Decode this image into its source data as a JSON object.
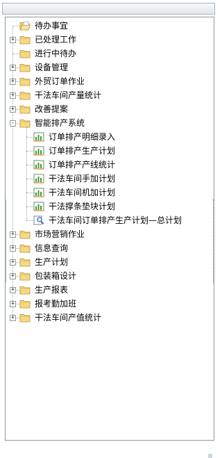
{
  "tree": {
    "items": [
      {
        "label": "待办事宜",
        "level": 0,
        "expander": "none",
        "icon": "folder-open-icon"
      },
      {
        "label": "已处理工作",
        "level": 0,
        "expander": "+",
        "icon": "folder-icon"
      },
      {
        "label": "进行中待办",
        "level": 0,
        "expander": "none",
        "icon": "folder-icon"
      },
      {
        "label": "设备管理",
        "level": 0,
        "expander": "+",
        "icon": "folder-icon"
      },
      {
        "label": "外贸订单作业",
        "level": 0,
        "expander": "+",
        "icon": "folder-icon"
      },
      {
        "label": "干法车间产量统计",
        "level": 0,
        "expander": "+",
        "icon": "folder-icon"
      },
      {
        "label": "改善提案",
        "level": 0,
        "expander": "+",
        "icon": "folder-icon"
      },
      {
        "label": "智能排产系统",
        "level": 0,
        "expander": "-",
        "icon": "folder-icon"
      },
      {
        "label": "订单排产明细录入",
        "level": 1,
        "expander": "none",
        "icon": "report-icon"
      },
      {
        "label": "订单排产生产计划",
        "level": 1,
        "expander": "none",
        "icon": "report-icon"
      },
      {
        "label": "订单排产产线统计",
        "level": 1,
        "expander": "none",
        "icon": "report-icon"
      },
      {
        "label": "干法车间手加计划",
        "level": 1,
        "expander": "none",
        "icon": "report-icon"
      },
      {
        "label": "干法车间机加计划",
        "level": 1,
        "expander": "none",
        "icon": "report-icon"
      },
      {
        "label": "干法撑条垫块计划",
        "level": 1,
        "expander": "none",
        "icon": "report-icon"
      },
      {
        "label": "干法车间订单排产生产计划—总计划",
        "level": 1,
        "expander": "none",
        "icon": "search-document-icon"
      },
      {
        "label": "市场营销作业",
        "level": 0,
        "expander": "+",
        "icon": "folder-icon"
      },
      {
        "label": "信息查询",
        "level": 0,
        "expander": "+",
        "icon": "folder-icon"
      },
      {
        "label": "生产计划",
        "level": 0,
        "expander": "+",
        "icon": "folder-icon"
      },
      {
        "label": "包装箱设计",
        "level": 0,
        "expander": "+",
        "icon": "folder-icon"
      },
      {
        "label": "生产报表",
        "level": 0,
        "expander": "+",
        "icon": "folder-icon"
      },
      {
        "label": "报考勤加班",
        "level": 0,
        "expander": "+",
        "icon": "folder-icon"
      },
      {
        "label": "干法车间产值统计",
        "level": 0,
        "expander": "+",
        "icon": "folder-icon"
      }
    ]
  }
}
